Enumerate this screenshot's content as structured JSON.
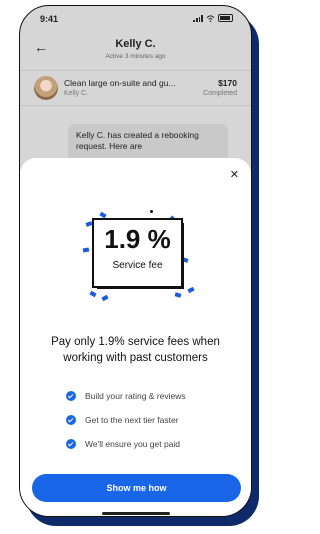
{
  "status": {
    "time": "9:41"
  },
  "header": {
    "name": "Kelly C.",
    "subtitle": "Active 3 minutes ago",
    "back_icon": "arrow-left-icon"
  },
  "job": {
    "title": "Clean large on-suite and gu...",
    "price": "$170",
    "customer": "Kelly C.",
    "status": "Completed"
  },
  "chat": {
    "message": "Kelly C. has created a rebooking request. Here are"
  },
  "modal": {
    "close_icon": "close-icon",
    "illustration": {
      "percent": "1.9 %",
      "label": "Service fee"
    },
    "headline_line1": "Pay only 1.9% service fees when",
    "headline_line2": "working with past customers",
    "benefits": [
      "Build your rating & reviews",
      "Get to the next tier faster",
      "We'll ensure you get paid"
    ],
    "cta": "Show me how"
  },
  "colors": {
    "accent": "#1a66e8",
    "shadow": "#0e2a6a"
  }
}
